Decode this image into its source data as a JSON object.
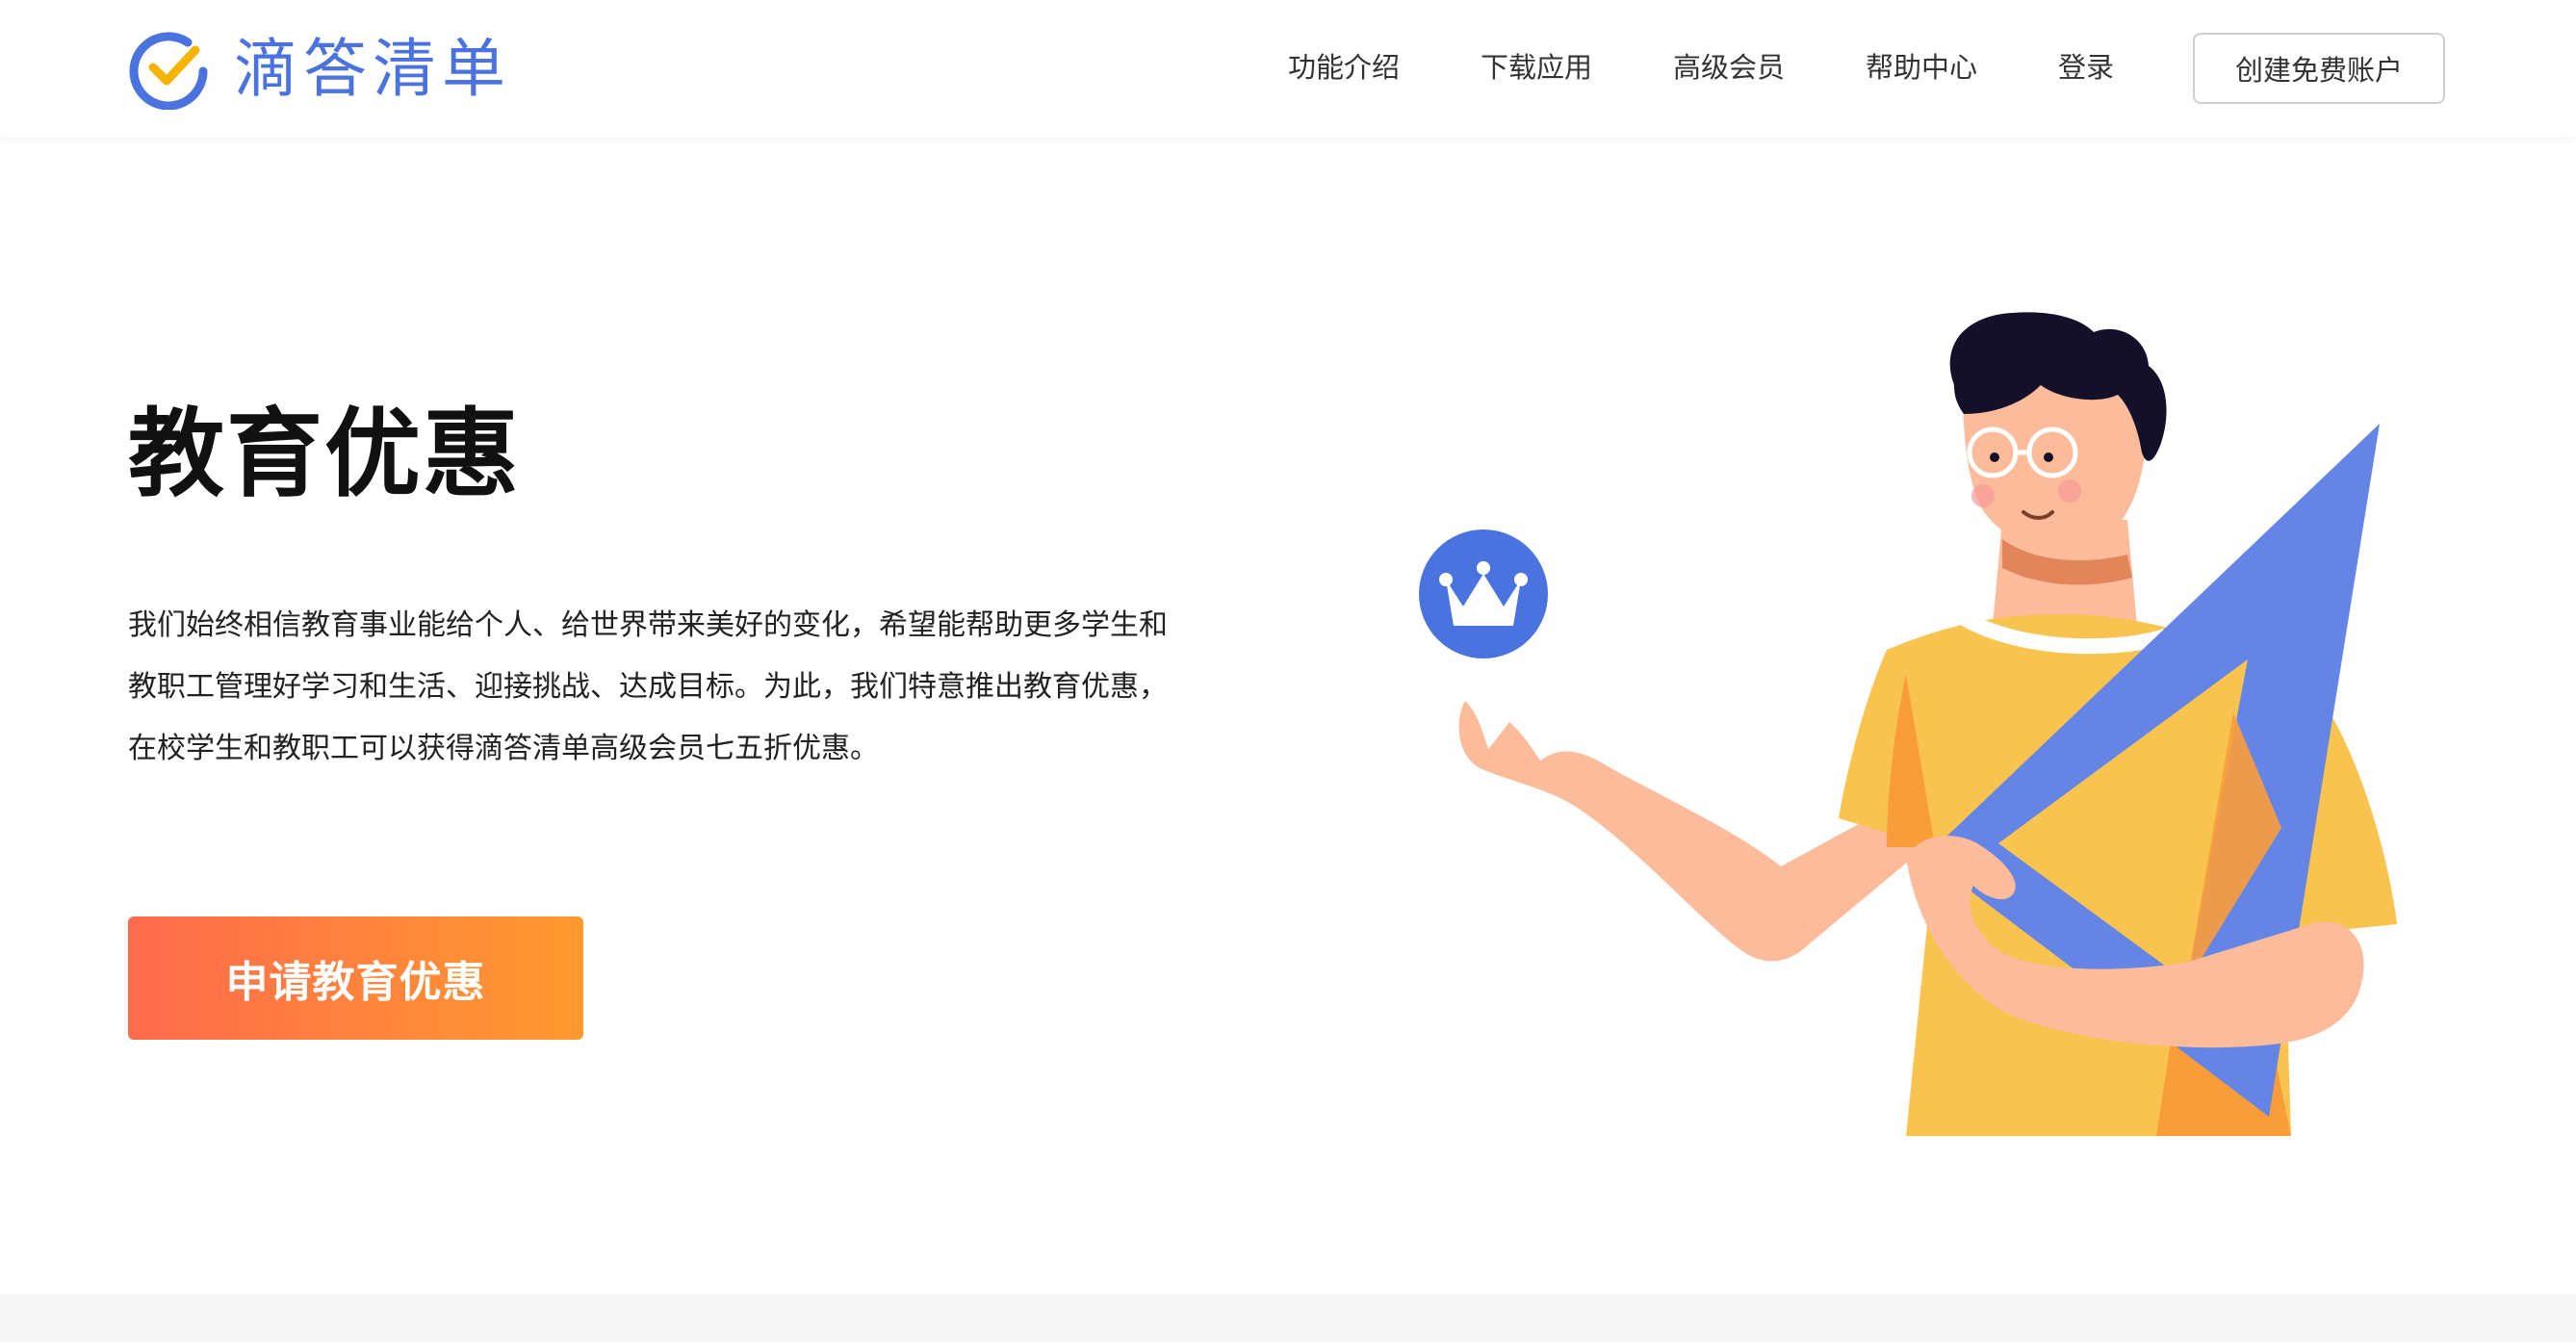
{
  "brand": {
    "name": "滴答清单",
    "logo_icon": "check-circle-icon",
    "accent_color": "#4a73e0",
    "check_color": "#f5b400"
  },
  "nav": {
    "items": [
      {
        "label": "功能介绍"
      },
      {
        "label": "下载应用"
      },
      {
        "label": "高级会员"
      },
      {
        "label": "帮助中心"
      },
      {
        "label": "登录"
      }
    ],
    "cta_label": "创建免费账户"
  },
  "hero": {
    "title": "教育优惠",
    "description_lines": [
      "我们始终相信教育事业能给个人、给世界带来美好的变化，希望能帮助更多学生和",
      "教职工管理好学习和生活、迎接挑战、达成目标。为此，我们特意推出教育优惠，",
      "在校学生和教职工可以获得滴答清单高级会员七五折优惠。"
    ],
    "button_label": "申请教育优惠",
    "button_gradient": [
      "#ff6b4d",
      "#ff9a2e"
    ]
  },
  "illustration": {
    "badge_icon": "crown-icon",
    "badge_color": "#4a73e0",
    "shirt_color": "#f8c44f",
    "ruler_color": "#6585e6",
    "skin_color": "#fcbb9a",
    "hair_color": "#15102a"
  }
}
